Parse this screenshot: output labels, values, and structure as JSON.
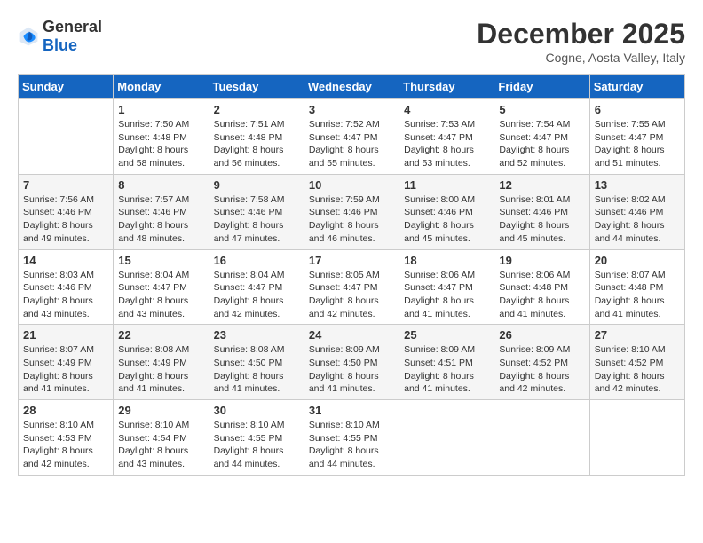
{
  "header": {
    "logo_general": "General",
    "logo_blue": "Blue",
    "month_title": "December 2025",
    "location": "Cogne, Aosta Valley, Italy"
  },
  "days_of_week": [
    "Sunday",
    "Monday",
    "Tuesday",
    "Wednesday",
    "Thursday",
    "Friday",
    "Saturday"
  ],
  "weeks": [
    [
      {
        "day": "",
        "sunrise": "",
        "sunset": "",
        "daylight": ""
      },
      {
        "day": "1",
        "sunrise": "Sunrise: 7:50 AM",
        "sunset": "Sunset: 4:48 PM",
        "daylight": "Daylight: 8 hours and 58 minutes."
      },
      {
        "day": "2",
        "sunrise": "Sunrise: 7:51 AM",
        "sunset": "Sunset: 4:48 PM",
        "daylight": "Daylight: 8 hours and 56 minutes."
      },
      {
        "day": "3",
        "sunrise": "Sunrise: 7:52 AM",
        "sunset": "Sunset: 4:47 PM",
        "daylight": "Daylight: 8 hours and 55 minutes."
      },
      {
        "day": "4",
        "sunrise": "Sunrise: 7:53 AM",
        "sunset": "Sunset: 4:47 PM",
        "daylight": "Daylight: 8 hours and 53 minutes."
      },
      {
        "day": "5",
        "sunrise": "Sunrise: 7:54 AM",
        "sunset": "Sunset: 4:47 PM",
        "daylight": "Daylight: 8 hours and 52 minutes."
      },
      {
        "day": "6",
        "sunrise": "Sunrise: 7:55 AM",
        "sunset": "Sunset: 4:47 PM",
        "daylight": "Daylight: 8 hours and 51 minutes."
      }
    ],
    [
      {
        "day": "7",
        "sunrise": "Sunrise: 7:56 AM",
        "sunset": "Sunset: 4:46 PM",
        "daylight": "Daylight: 8 hours and 49 minutes."
      },
      {
        "day": "8",
        "sunrise": "Sunrise: 7:57 AM",
        "sunset": "Sunset: 4:46 PM",
        "daylight": "Daylight: 8 hours and 48 minutes."
      },
      {
        "day": "9",
        "sunrise": "Sunrise: 7:58 AM",
        "sunset": "Sunset: 4:46 PM",
        "daylight": "Daylight: 8 hours and 47 minutes."
      },
      {
        "day": "10",
        "sunrise": "Sunrise: 7:59 AM",
        "sunset": "Sunset: 4:46 PM",
        "daylight": "Daylight: 8 hours and 46 minutes."
      },
      {
        "day": "11",
        "sunrise": "Sunrise: 8:00 AM",
        "sunset": "Sunset: 4:46 PM",
        "daylight": "Daylight: 8 hours and 45 minutes."
      },
      {
        "day": "12",
        "sunrise": "Sunrise: 8:01 AM",
        "sunset": "Sunset: 4:46 PM",
        "daylight": "Daylight: 8 hours and 45 minutes."
      },
      {
        "day": "13",
        "sunrise": "Sunrise: 8:02 AM",
        "sunset": "Sunset: 4:46 PM",
        "daylight": "Daylight: 8 hours and 44 minutes."
      }
    ],
    [
      {
        "day": "14",
        "sunrise": "Sunrise: 8:03 AM",
        "sunset": "Sunset: 4:46 PM",
        "daylight": "Daylight: 8 hours and 43 minutes."
      },
      {
        "day": "15",
        "sunrise": "Sunrise: 8:04 AM",
        "sunset": "Sunset: 4:47 PM",
        "daylight": "Daylight: 8 hours and 43 minutes."
      },
      {
        "day": "16",
        "sunrise": "Sunrise: 8:04 AM",
        "sunset": "Sunset: 4:47 PM",
        "daylight": "Daylight: 8 hours and 42 minutes."
      },
      {
        "day": "17",
        "sunrise": "Sunrise: 8:05 AM",
        "sunset": "Sunset: 4:47 PM",
        "daylight": "Daylight: 8 hours and 42 minutes."
      },
      {
        "day": "18",
        "sunrise": "Sunrise: 8:06 AM",
        "sunset": "Sunset: 4:47 PM",
        "daylight": "Daylight: 8 hours and 41 minutes."
      },
      {
        "day": "19",
        "sunrise": "Sunrise: 8:06 AM",
        "sunset": "Sunset: 4:48 PM",
        "daylight": "Daylight: 8 hours and 41 minutes."
      },
      {
        "day": "20",
        "sunrise": "Sunrise: 8:07 AM",
        "sunset": "Sunset: 4:48 PM",
        "daylight": "Daylight: 8 hours and 41 minutes."
      }
    ],
    [
      {
        "day": "21",
        "sunrise": "Sunrise: 8:07 AM",
        "sunset": "Sunset: 4:49 PM",
        "daylight": "Daylight: 8 hours and 41 minutes."
      },
      {
        "day": "22",
        "sunrise": "Sunrise: 8:08 AM",
        "sunset": "Sunset: 4:49 PM",
        "daylight": "Daylight: 8 hours and 41 minutes."
      },
      {
        "day": "23",
        "sunrise": "Sunrise: 8:08 AM",
        "sunset": "Sunset: 4:50 PM",
        "daylight": "Daylight: 8 hours and 41 minutes."
      },
      {
        "day": "24",
        "sunrise": "Sunrise: 8:09 AM",
        "sunset": "Sunset: 4:50 PM",
        "daylight": "Daylight: 8 hours and 41 minutes."
      },
      {
        "day": "25",
        "sunrise": "Sunrise: 8:09 AM",
        "sunset": "Sunset: 4:51 PM",
        "daylight": "Daylight: 8 hours and 41 minutes."
      },
      {
        "day": "26",
        "sunrise": "Sunrise: 8:09 AM",
        "sunset": "Sunset: 4:52 PM",
        "daylight": "Daylight: 8 hours and 42 minutes."
      },
      {
        "day": "27",
        "sunrise": "Sunrise: 8:10 AM",
        "sunset": "Sunset: 4:52 PM",
        "daylight": "Daylight: 8 hours and 42 minutes."
      }
    ],
    [
      {
        "day": "28",
        "sunrise": "Sunrise: 8:10 AM",
        "sunset": "Sunset: 4:53 PM",
        "daylight": "Daylight: 8 hours and 42 minutes."
      },
      {
        "day": "29",
        "sunrise": "Sunrise: 8:10 AM",
        "sunset": "Sunset: 4:54 PM",
        "daylight": "Daylight: 8 hours and 43 minutes."
      },
      {
        "day": "30",
        "sunrise": "Sunrise: 8:10 AM",
        "sunset": "Sunset: 4:55 PM",
        "daylight": "Daylight: 8 hours and 44 minutes."
      },
      {
        "day": "31",
        "sunrise": "Sunrise: 8:10 AM",
        "sunset": "Sunset: 4:55 PM",
        "daylight": "Daylight: 8 hours and 44 minutes."
      },
      {
        "day": "",
        "sunrise": "",
        "sunset": "",
        "daylight": ""
      },
      {
        "day": "",
        "sunrise": "",
        "sunset": "",
        "daylight": ""
      },
      {
        "day": "",
        "sunrise": "",
        "sunset": "",
        "daylight": ""
      }
    ]
  ]
}
